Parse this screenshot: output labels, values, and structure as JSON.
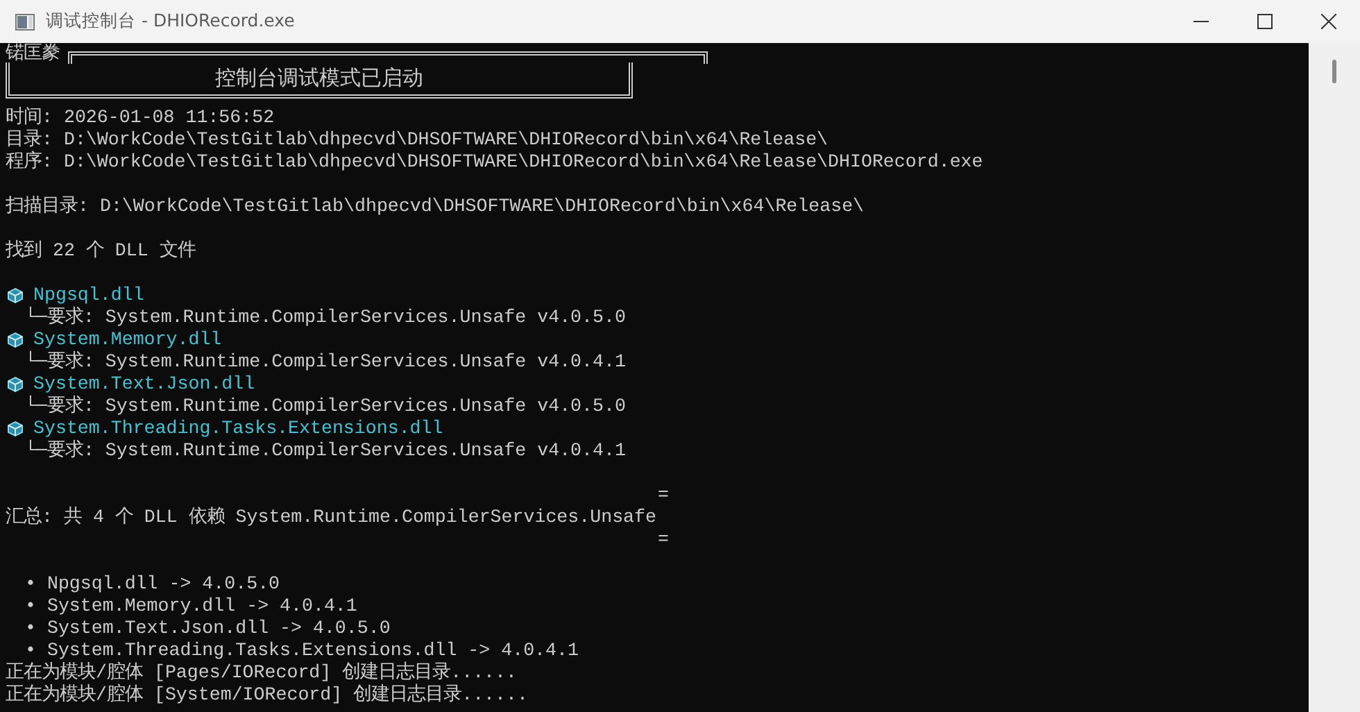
{
  "window": {
    "title": "调试控制台 - DHIORecord.exe"
  },
  "console": {
    "header": "锘匡豢",
    "banner": "控制台调试模式已启动",
    "info_lines": [
      "时间: 2026-01-08 11:56:52",
      "目录: D:\\WorkCode\\TestGitlab\\dhpecvd\\DHSOFTWARE\\DHIORecord\\bin\\x64\\Release\\",
      "程序: D:\\WorkCode\\TestGitlab\\dhpecvd\\DHSOFTWARE\\DHIORecord\\bin\\x64\\Release\\DHIORecord.exe"
    ],
    "scan_line": "扫描目录: D:\\WorkCode\\TestGitlab\\dhpecvd\\DHSOFTWARE\\DHIORecord\\bin\\x64\\Release\\",
    "found_line": "找到 22 个 DLL 文件",
    "dlls": [
      {
        "name": "Npgsql.dll",
        "requirement": "└─要求: System.Runtime.CompilerServices.Unsafe v4.0.5.0"
      },
      {
        "name": "System.Memory.dll",
        "requirement": "└─要求: System.Runtime.CompilerServices.Unsafe v4.0.4.1"
      },
      {
        "name": "System.Text.Json.dll",
        "requirement": "└─要求: System.Runtime.CompilerServices.Unsafe v4.0.5.0"
      },
      {
        "name": "System.Threading.Tasks.Extensions.dll",
        "requirement": "└─要求: System.Runtime.CompilerServices.Unsafe v4.0.4.1"
      }
    ],
    "summary": {
      "separator_top": "=",
      "text": "汇总: 共 4 个 DLL 依赖 System.Runtime.CompilerServices.Unsafe",
      "separator_bottom": "="
    },
    "versions": [
      "• Npgsql.dll -> 4.0.5.0",
      "• System.Memory.dll -> 4.0.4.1",
      "• System.Text.Json.dll -> 4.0.5.0",
      "• System.Threading.Tasks.Extensions.dll -> 4.0.4.1"
    ],
    "log_lines": [
      "正在为模块/腔体 [Pages/IORecord] 创建日志目录......",
      "正在为模块/腔体 [System/IORecord] 创建日志目录......"
    ]
  }
}
